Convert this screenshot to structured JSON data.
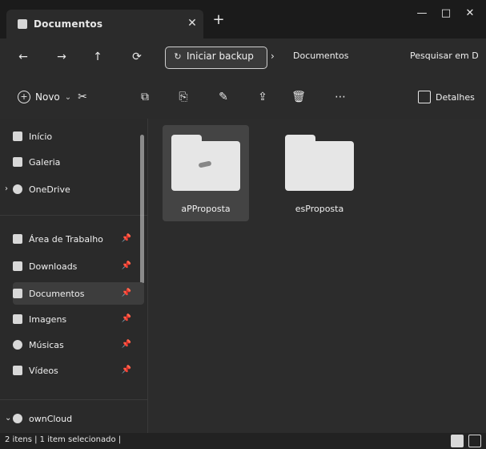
{
  "window": {
    "tab_title": "Documentos",
    "tab_close_icon": "close-icon",
    "tab_add_icon": "plus-icon",
    "controls": {
      "minimize_icon": "minimize-icon",
      "maximize_icon": "maximize-icon",
      "close_icon": "close-icon"
    }
  },
  "address": {
    "nav": {
      "back_icon": "arrow-left-icon",
      "forward_icon": "arrow-right-icon",
      "up_icon": "arrow-up-icon",
      "refresh_icon": "refresh-icon"
    },
    "backup_label": "Iniciar backup",
    "current_folder": "Documentos",
    "search_placeholder": "Pesquisar em D"
  },
  "commandbar": {
    "new_label": "Novo",
    "details_label": "Detalhes",
    "icons": {
      "cut": "scissors-icon",
      "copy": "copy-icon",
      "paste": "paste-icon",
      "rename": "rename-icon",
      "share": "share-icon",
      "delete": "trash-icon",
      "more": "more-icon"
    }
  },
  "sidebar": {
    "items": [
      {
        "label": "Início"
      },
      {
        "label": "Galeria"
      },
      {
        "label": "OneDrive"
      },
      {
        "label": "Área de Trabalho"
      },
      {
        "label": "Downloads"
      },
      {
        "label": "Documentos"
      },
      {
        "label": "Imagens"
      },
      {
        "label": "Músicas"
      },
      {
        "label": "Vídeos"
      },
      {
        "label": "ownCloud"
      }
    ]
  },
  "main": {
    "files": [
      {
        "name": "aPProposta",
        "selected": true
      },
      {
        "name": "esProposta",
        "selected": false
      }
    ]
  },
  "statusbar": {
    "text": "2 itens | 1 item selecionado |"
  }
}
